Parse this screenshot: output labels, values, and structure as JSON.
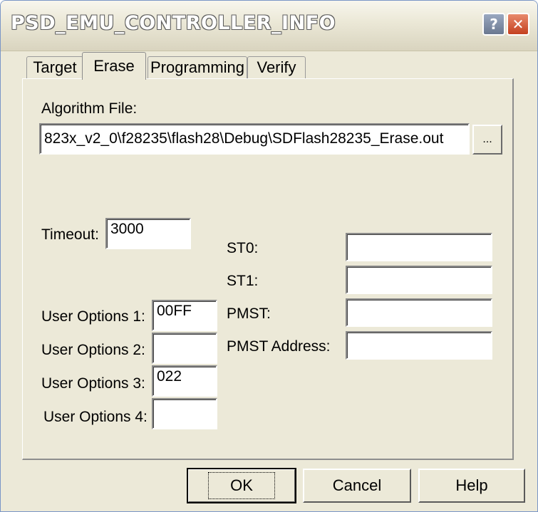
{
  "window": {
    "title": "PSD_EMU_CONTROLLER_INFO"
  },
  "titlebar": {
    "help_label": "?",
    "close_label": "✕"
  },
  "tabs": [
    {
      "label": "Target",
      "active": false
    },
    {
      "label": "Erase",
      "active": true
    },
    {
      "label": "Programming",
      "active": false
    },
    {
      "label": "Verify",
      "active": false
    }
  ],
  "erase": {
    "algorithm_file_label": "Algorithm File:",
    "algorithm_file_value": "823x_v2_0\\f28235\\flash28\\Debug\\SDFlash28235_Erase.out",
    "browse_label": "...",
    "timeout_label": "Timeout:",
    "timeout_value": "3000",
    "user_options": [
      {
        "label": "User Options 1:",
        "value": "00FF"
      },
      {
        "label": "User Options 2:",
        "value": ""
      },
      {
        "label": "User Options 3:",
        "value": "022"
      },
      {
        "label": "User Options 4:",
        "value": ""
      }
    ],
    "registers": [
      {
        "label": "ST0:",
        "value": ""
      },
      {
        "label": "ST1:",
        "value": ""
      },
      {
        "label": "PMST:",
        "value": ""
      },
      {
        "label": "PMST Address:",
        "value": ""
      }
    ]
  },
  "buttons": {
    "ok": "OK",
    "cancel": "Cancel",
    "help": "Help"
  }
}
